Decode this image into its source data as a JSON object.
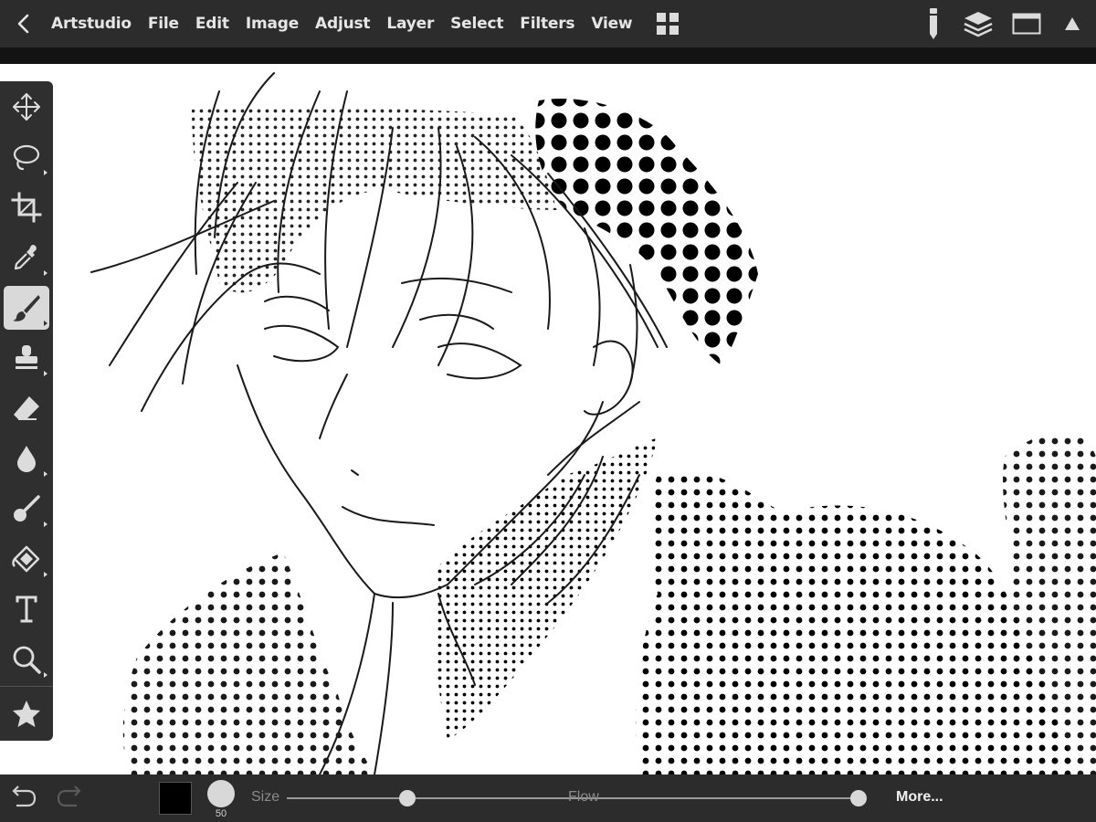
{
  "app": {
    "name": "Artstudio",
    "menu": [
      "File",
      "Edit",
      "Image",
      "Adjust",
      "Layer",
      "Select",
      "Filters",
      "View"
    ]
  },
  "toolbar": {
    "icons": [
      "back-chevron-icon",
      "grid-icon",
      "pencil-brush-icon",
      "layers-icon",
      "window-icon",
      "triangle-up-icon"
    ]
  },
  "tools": [
    {
      "name": "move",
      "icon": "move-icon",
      "has_submenu": false,
      "active": false
    },
    {
      "name": "lasso",
      "icon": "lasso-icon",
      "has_submenu": true,
      "active": false
    },
    {
      "name": "crop",
      "icon": "crop-icon",
      "has_submenu": false,
      "active": false
    },
    {
      "name": "eyedropper",
      "icon": "eyedropper-icon",
      "has_submenu": true,
      "active": false
    },
    {
      "name": "brush",
      "icon": "brush-icon",
      "has_submenu": true,
      "active": true
    },
    {
      "name": "stamp",
      "icon": "stamp-icon",
      "has_submenu": true,
      "active": false
    },
    {
      "name": "eraser",
      "icon": "eraser-icon",
      "has_submenu": false,
      "active": false
    },
    {
      "name": "blur",
      "icon": "drop-icon",
      "has_submenu": true,
      "active": false
    },
    {
      "name": "smudge",
      "icon": "smudge-icon",
      "has_submenu": true,
      "active": false
    },
    {
      "name": "fill",
      "icon": "fill-bucket-icon",
      "has_submenu": true,
      "active": false
    },
    {
      "name": "text",
      "icon": "text-icon",
      "has_submenu": false,
      "active": false
    },
    {
      "name": "zoom",
      "icon": "zoom-icon",
      "has_submenu": true,
      "active": false
    },
    {
      "name": "favorites",
      "icon": "star-icon",
      "has_submenu": false,
      "active": false
    }
  ],
  "bottom": {
    "color": "#000000",
    "brush_size_value": "50",
    "size_label": "Size",
    "size_value_fraction": 0.33,
    "flow_label": "Flow",
    "flow_value_fraction": 1.0,
    "more_label": "More..."
  },
  "colors": {
    "bar_bg": "#2c2c2c",
    "panel_bg": "#2f2f2f",
    "active_tool_bg": "#d9d9d9",
    "icon": "#dcdcdc"
  }
}
